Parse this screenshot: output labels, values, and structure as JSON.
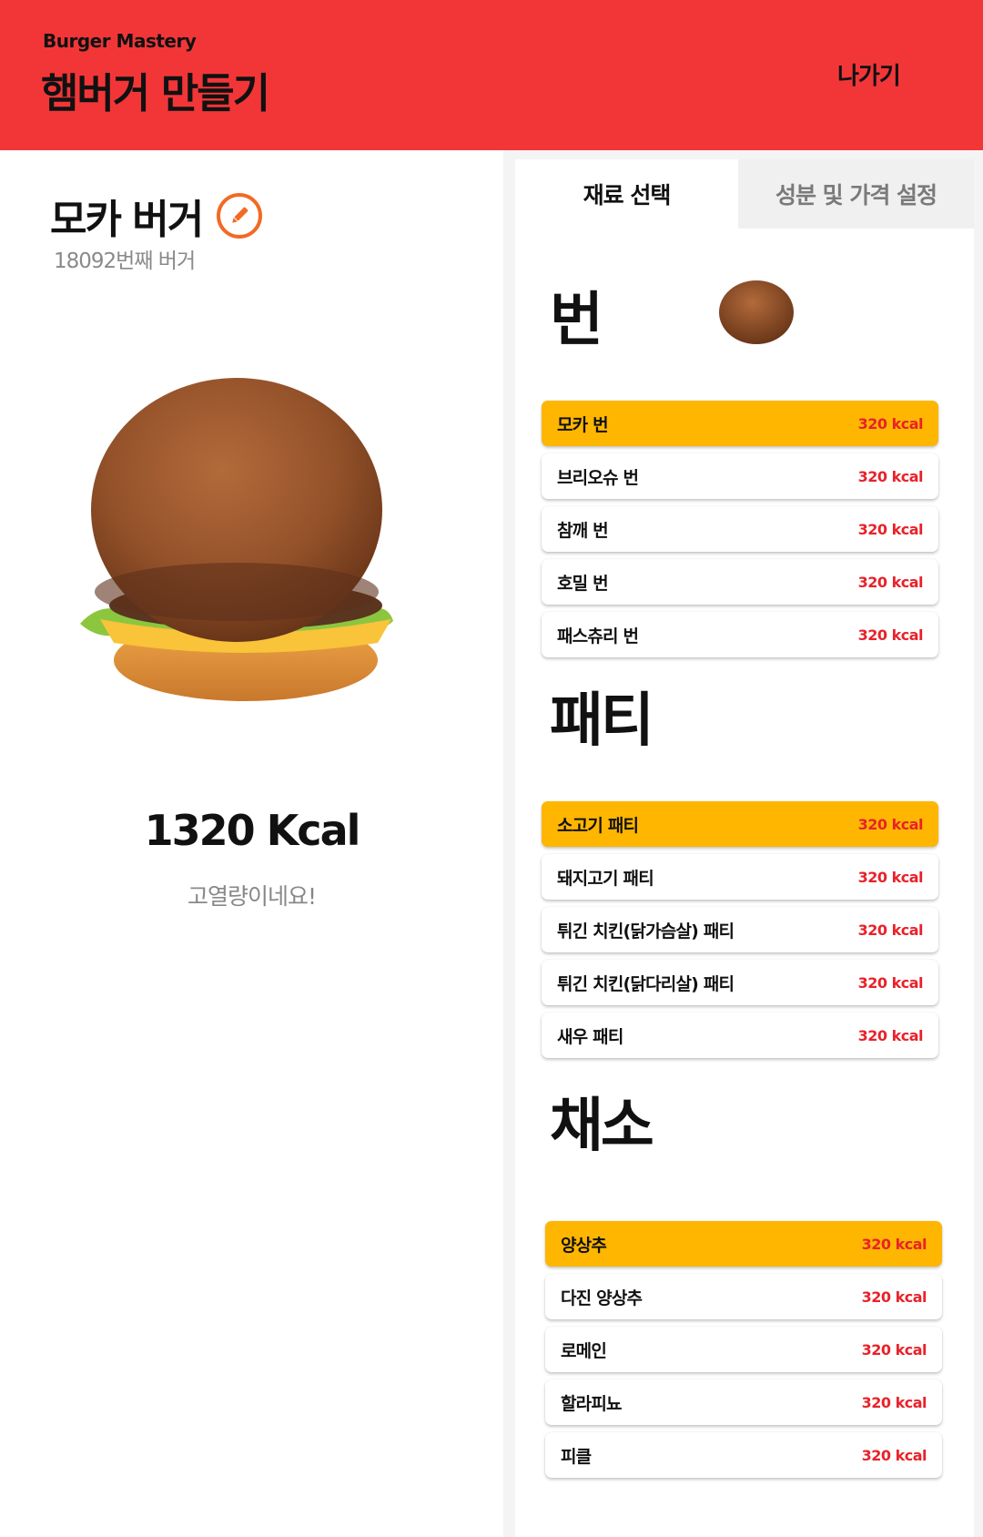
{
  "header": {
    "brand": "Burger Mastery",
    "title": "햄버거 만들기",
    "exit_label": "나가기"
  },
  "burger": {
    "name": "모카 버거",
    "count_label": "18092번째 버거",
    "total_kcal": "1320 Kcal",
    "comment": "고열량이네요!"
  },
  "tabs": [
    {
      "label": "재료 선택",
      "active": true
    },
    {
      "label": "성분 및 가격 설정",
      "active": false
    }
  ],
  "sections": {
    "bun": {
      "title": "번",
      "items": [
        {
          "name": "모카 번",
          "kcal": "320 kcal",
          "selected": true
        },
        {
          "name": "브리오슈 번",
          "kcal": "320 kcal",
          "selected": false
        },
        {
          "name": "참깨 번",
          "kcal": "320 kcal",
          "selected": false
        },
        {
          "name": "호밀 번",
          "kcal": "320 kcal",
          "selected": false
        },
        {
          "name": "패스츄리 번",
          "kcal": "320 kcal",
          "selected": false
        }
      ]
    },
    "patty": {
      "title": "패티",
      "items": [
        {
          "name": "소고기 패티",
          "kcal": "320 kcal",
          "selected": true
        },
        {
          "name": "돼지고기 패티",
          "kcal": "320 kcal",
          "selected": false
        },
        {
          "name": "튀긴 치킨(닭가슴살) 패티",
          "kcal": "320 kcal",
          "selected": false
        },
        {
          "name": "튀긴 치킨(닭다리살) 패티",
          "kcal": "320 kcal",
          "selected": false
        },
        {
          "name": "새우 패티",
          "kcal": "320 kcal",
          "selected": false
        }
      ]
    },
    "veg": {
      "title": "채소",
      "items": [
        {
          "name": "양상추",
          "kcal": "320 kcal",
          "selected": true
        },
        {
          "name": "다진 양상추",
          "kcal": "320 kcal",
          "selected": false
        },
        {
          "name": "로메인",
          "kcal": "320 kcal",
          "selected": false
        },
        {
          "name": "할라피뇨",
          "kcal": "320 kcal",
          "selected": false
        },
        {
          "name": "피클",
          "kcal": "320 kcal",
          "selected": false
        }
      ]
    }
  },
  "colors": {
    "header_bg": "#f23638",
    "selected_item": "#ffb600",
    "kcal_text": "#e8222a",
    "edit_icon": "#f26a24"
  }
}
